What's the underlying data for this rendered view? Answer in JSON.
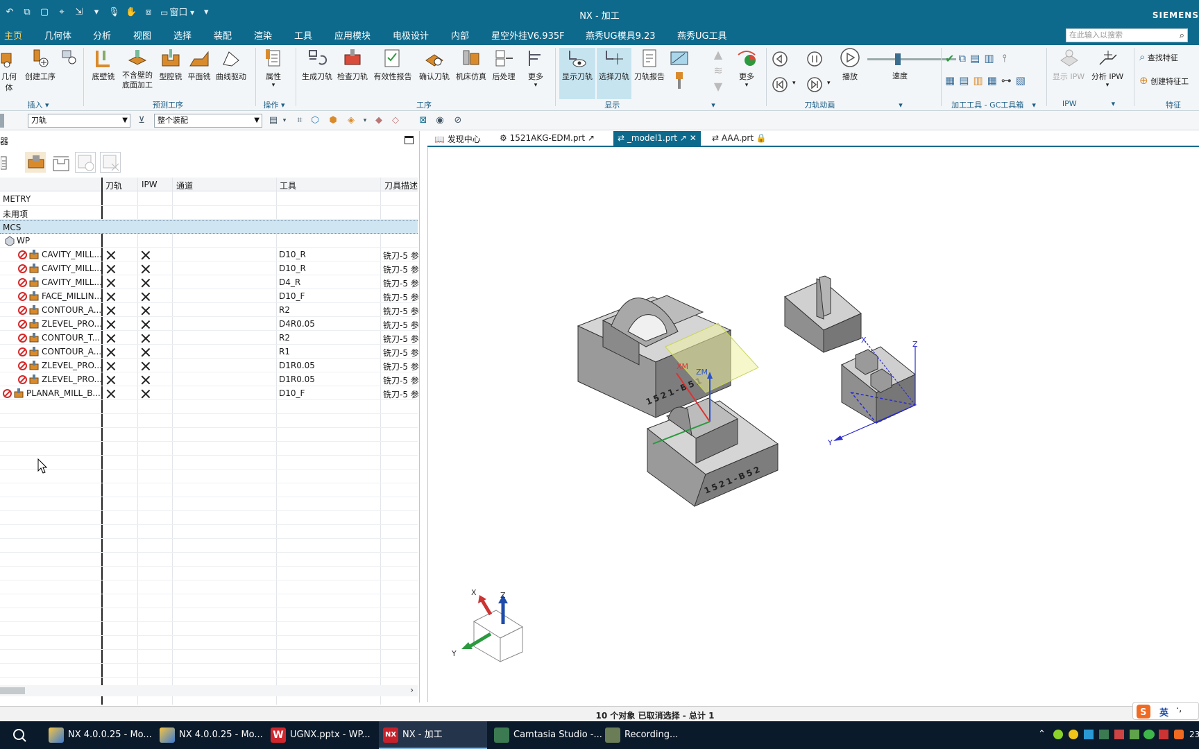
{
  "window": {
    "title": "NX - 加工",
    "brand": "SIEMENS",
    "qat_window": "窗口"
  },
  "menu": {
    "items": [
      "主页",
      "几何体",
      "分析",
      "视图",
      "选择",
      "装配",
      "渲染",
      "工具",
      "应用模块",
      "电极设计",
      "内部",
      "星空外挂V6.935F",
      "燕秀UG模具9.23",
      "燕秀UG工具"
    ],
    "search_placeholder": "在此输入以搜索"
  },
  "ribbon": {
    "buttons": {
      "geometry": "几何体",
      "create_op": "创建工序",
      "floor_wall": "底壁铣",
      "no_wall_floor": "不含壁的底面加工",
      "cavity": "型腔铣",
      "plane": "平面铣",
      "curve_drive": "曲线驱动",
      "properties": "属性",
      "gen_toolpath": "生成刀轨",
      "verify": "检查刀轨",
      "validity": "有效性报告",
      "confirm": "确认刀轨",
      "sim": "机床仿真",
      "post": "后处理",
      "more1": "更多",
      "show_path": "显示刀轨",
      "select_path": "选择刀轨",
      "path_report": "刀轨报告",
      "more2": "更多",
      "play": "播放",
      "speed": "速度",
      "show_ipw": "显示 IPW",
      "analyze_ipw": "分析 IPW",
      "find_feature": "查找特征",
      "create_feature": "创建特征工"
    },
    "groups": {
      "insert": "插入",
      "predict": "预测工序",
      "ops": "操作",
      "process": "工序",
      "display": "显示",
      "animation": "刀轨动画",
      "gc": "加工工具 - GC工具箱",
      "ipw": "IPW",
      "feature": "特征"
    }
  },
  "filter_bar": {
    "type_filter": "刀轨",
    "scope_filter": "整个装配"
  },
  "navigator": {
    "title": "器",
    "columns": [
      "刀轨",
      "IPW",
      "通道",
      "工具",
      "刀具描述"
    ],
    "rows": [
      {
        "name": "METRY",
        "tool": "",
        "desc": "",
        "indent": 0,
        "x": false
      },
      {
        "name": "未用项",
        "tool": "",
        "desc": "",
        "indent": 0,
        "x": false
      },
      {
        "name": "MCS",
        "tool": "",
        "desc": "",
        "indent": 0,
        "x": false
      },
      {
        "name": "WP",
        "tool": "",
        "desc": "",
        "indent": 1,
        "x": false
      },
      {
        "name": "CAVITY_MILL...",
        "tool": "D10_R",
        "desc": "铣刀-5 参",
        "indent": 2,
        "x": true
      },
      {
        "name": "CAVITY_MILL...",
        "tool": "D10_R",
        "desc": "铣刀-5 参",
        "indent": 2,
        "x": true
      },
      {
        "name": "CAVITY_MILL...",
        "tool": "D4_R",
        "desc": "铣刀-5 参",
        "indent": 2,
        "x": true
      },
      {
        "name": "FACE_MILLIN...",
        "tool": "D10_F",
        "desc": "铣刀-5 参",
        "indent": 2,
        "x": true
      },
      {
        "name": "CONTOUR_A...",
        "tool": "R2",
        "desc": "铣刀-5 参",
        "indent": 2,
        "x": true
      },
      {
        "name": "ZLEVEL_PRO...",
        "tool": "D4R0.05",
        "desc": "铣刀-5 参",
        "indent": 2,
        "x": true
      },
      {
        "name": "CONTOUR_T...",
        "tool": "R2",
        "desc": "铣刀-5 参",
        "indent": 2,
        "x": true
      },
      {
        "name": "CONTOUR_A...",
        "tool": "R1",
        "desc": "铣刀-5 参",
        "indent": 2,
        "x": true
      },
      {
        "name": "ZLEVEL_PRO...",
        "tool": "D1R0.05",
        "desc": "铣刀-5 参",
        "indent": 2,
        "x": true
      },
      {
        "name": "ZLEVEL_PRO...",
        "tool": "D1R0.05",
        "desc": "铣刀-5 参",
        "indent": 2,
        "x": true
      },
      {
        "name": "PLANAR_MILL_B...",
        "tool": "D10_F",
        "desc": "铣刀-5 参",
        "indent": 1,
        "x": true
      }
    ]
  },
  "tabs": [
    "发现中心",
    "1521AKG-EDM.prt",
    "_model1.prt",
    "AAA.prt"
  ],
  "viewport": {
    "labels": {
      "xm": "XM",
      "zm": "ZM",
      "x": "X",
      "y": "Y",
      "z": "Z",
      "part1": "1521-B51",
      "part2": "1521-B52"
    },
    "triad": {
      "x": "X",
      "y": "Y",
      "z": "Z"
    }
  },
  "status": "10 个对象 已取消选择 - 总计 1",
  "taskbar": {
    "items": [
      "NX 4.0.0.25 - Mo...",
      "NX 4.0.0.25 - Mo...",
      "UGNX.pptx - WP...",
      "NX - 加工",
      "Camtasia Studio -...",
      "Recording..."
    ],
    "ime": "英",
    "clock": "23"
  },
  "colors": {
    "accent": "#0e6a8c",
    "taskbar": "#0b1a2b",
    "selection": "#cfe5f1",
    "error": "#d42a2a"
  }
}
